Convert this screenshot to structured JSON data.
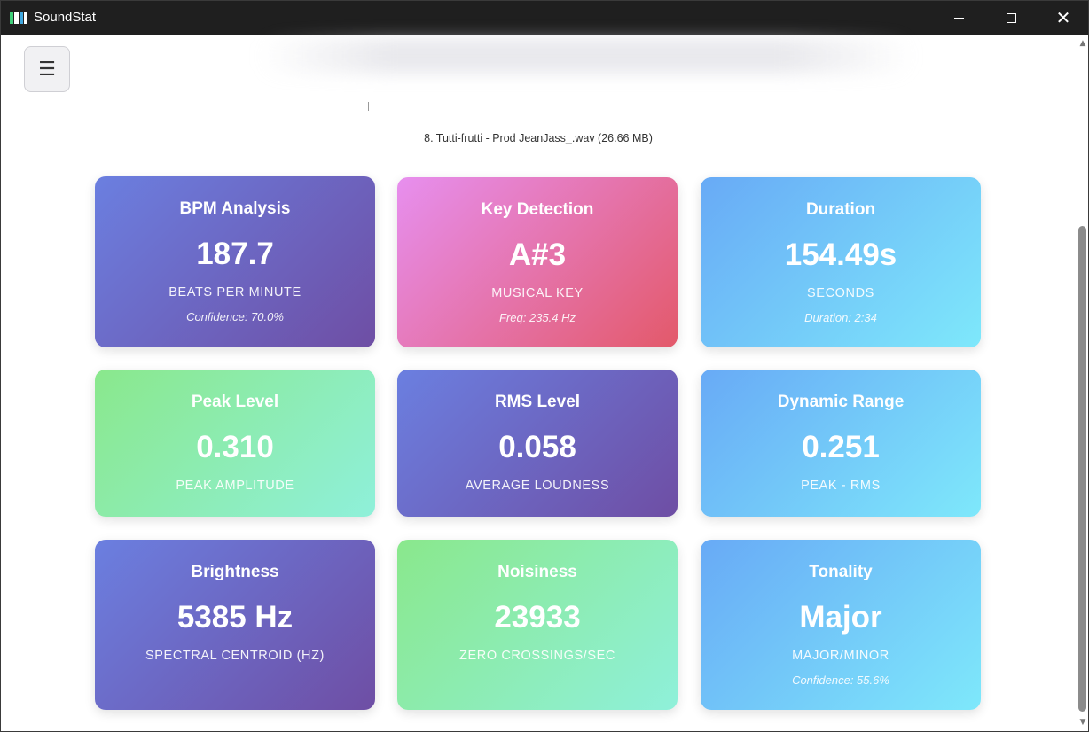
{
  "window": {
    "title": "SoundStat",
    "minimize_glyph": "",
    "close_glyph": "✕"
  },
  "menu": {
    "icon_glyph": "☰"
  },
  "file": {
    "name": "8. Tutti-frutti - Prod JeanJass_.wav (26.66 MB)"
  },
  "cards": [
    {
      "title": "BPM Analysis",
      "value": "187.7",
      "label": "Beats per minute",
      "sub": "Confidence: 70.0%",
      "theme": "purple"
    },
    {
      "title": "Key Detection",
      "value": "A#3",
      "label": "Musical key",
      "sub": "Freq: 235.4 Hz",
      "theme": "pink"
    },
    {
      "title": "Duration",
      "value": "154.49s",
      "label": "Seconds",
      "sub": "Duration: 2:34",
      "theme": "blue"
    },
    {
      "title": "Peak Level",
      "value": "0.310",
      "label": "Peak amplitude",
      "sub": "",
      "theme": "green"
    },
    {
      "title": "RMS Level",
      "value": "0.058",
      "label": "Average loudness",
      "sub": "",
      "theme": "purple"
    },
    {
      "title": "Dynamic Range",
      "value": "0.251",
      "label": "Peak - RMS",
      "sub": "",
      "theme": "blue"
    },
    {
      "title": "Brightness",
      "value": "5385 Hz",
      "label": "Spectral centroid (Hz)",
      "sub": "",
      "theme": "purple"
    },
    {
      "title": "Noisiness",
      "value": "23933",
      "label": "Zero crossings/sec",
      "sub": "",
      "theme": "green"
    },
    {
      "title": "Tonality",
      "value": "Major",
      "label": "Major/Minor",
      "sub": "Confidence: 55.6%",
      "theme": "blue"
    }
  ],
  "colors": {
    "purple": [
      "#6b7fe0",
      "#6e4ea4"
    ],
    "pink": [
      "#e78fef",
      "#e3596a"
    ],
    "blue": [
      "#68aaf6",
      "#7ee8fb"
    ],
    "green": [
      "#8ae88c",
      "#8ff0da"
    ],
    "titlebar": "#1f1f1f"
  }
}
